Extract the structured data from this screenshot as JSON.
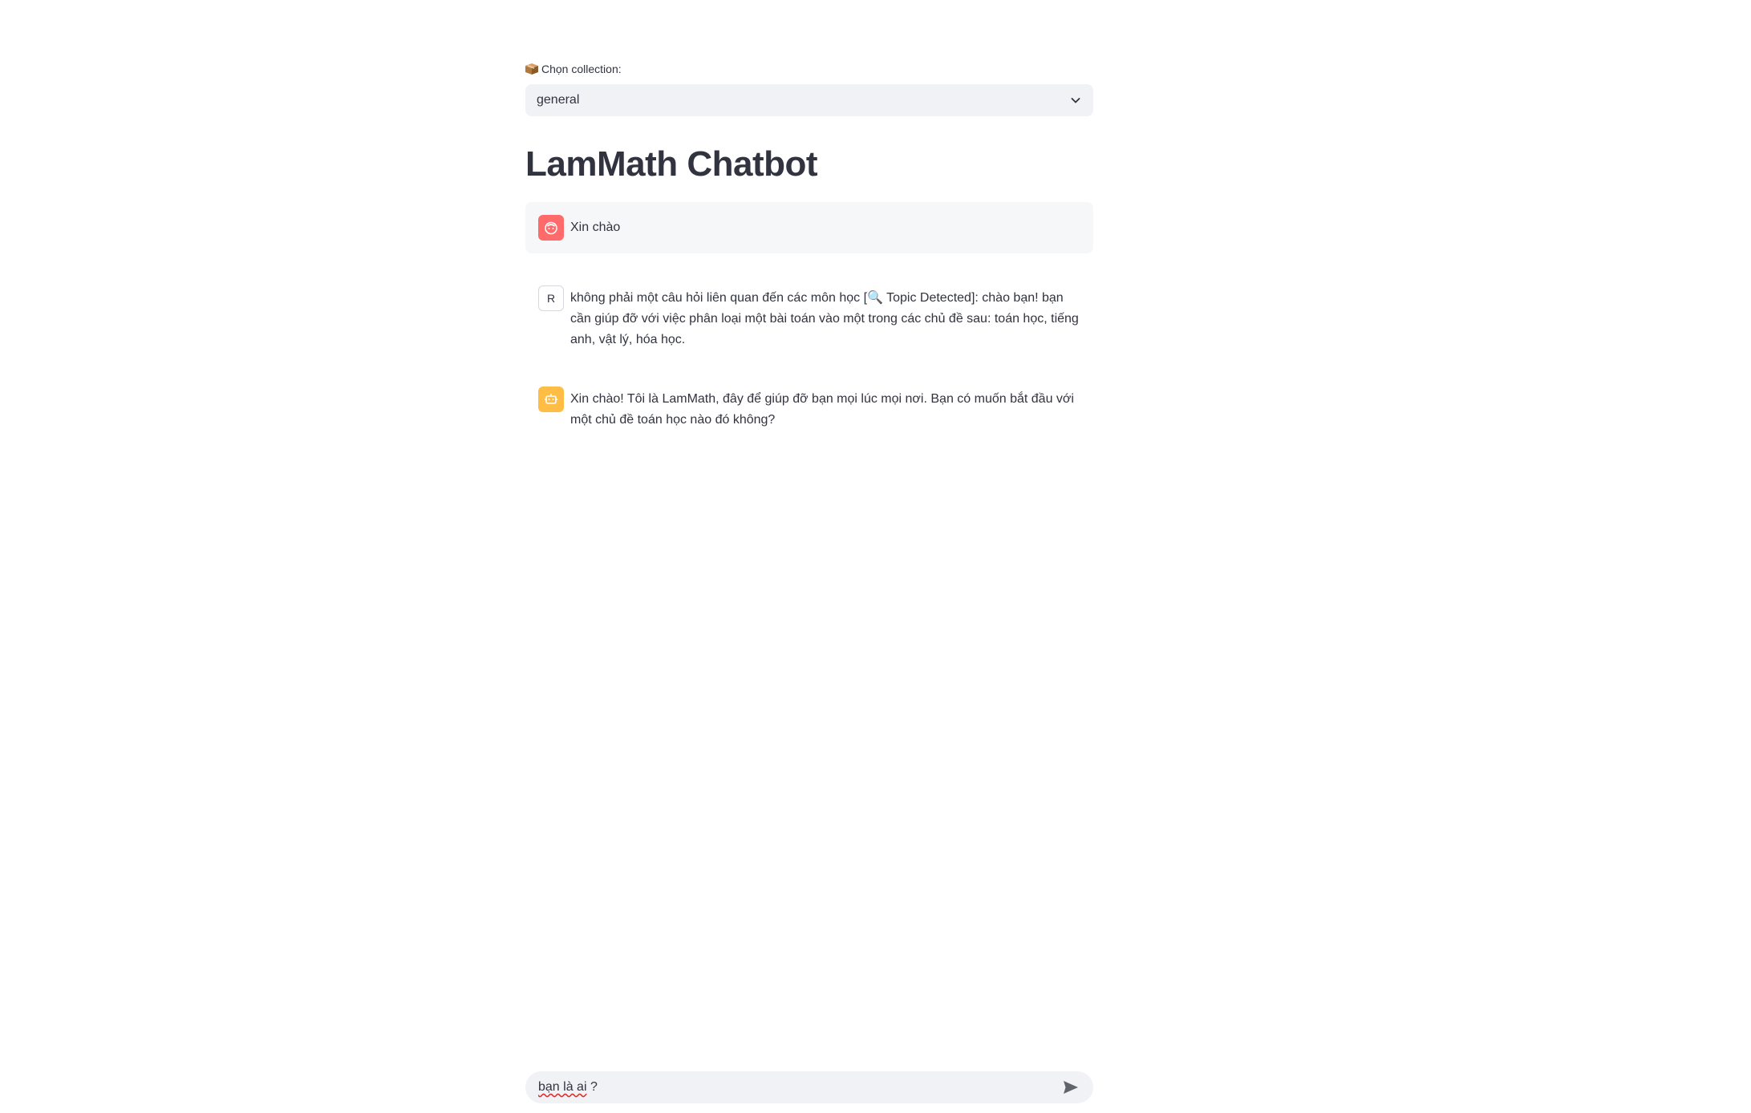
{
  "collection": {
    "label": "Chọn collection:",
    "selected": "general"
  },
  "title": "LamMath Chatbot",
  "messages": [
    {
      "role": "user",
      "avatar": "user-avatar-icon",
      "text": "Xin chào"
    },
    {
      "role": "r",
      "avatar_letter": "R",
      "text": "không phải một câu hỏi liên quan đến các môn học [🔍 Topic Detected]: chào bạn! bạn cần giúp đỡ với việc phân loại một bài toán vào một trong các chủ đề sau: toán học, tiếng anh, vật lý, hóa học."
    },
    {
      "role": "assistant",
      "avatar": "bot-avatar-icon",
      "text": "Xin chào! Tôi là LamMath, đây để giúp đỡ bạn mọi lúc mọi nơi. Bạn có muốn bắt đầu với một chủ đề toán học nào đó không?"
    }
  ],
  "chat_input": {
    "value_pre": "bạn là ai",
    "value_post": " ?"
  },
  "colors": {
    "user_avatar": "#ff6b6b",
    "bot_avatar": "#ffbd45",
    "input_bg": "#f0f2f6"
  }
}
